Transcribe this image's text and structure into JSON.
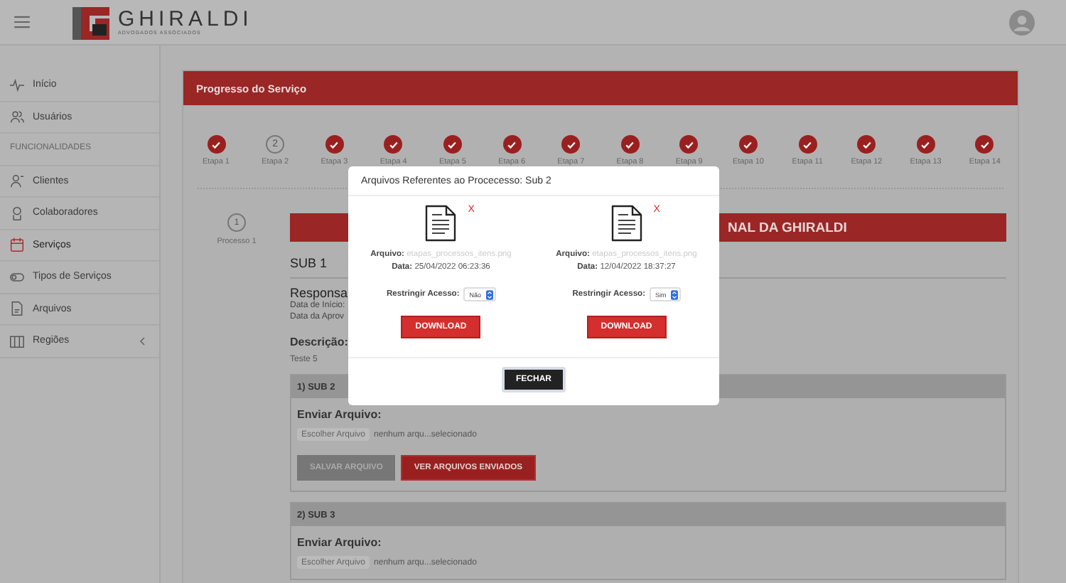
{
  "header": {
    "logo_text": "GHIRALDI",
    "logo_subtitle": "ADVOGADOS ASSOCIADOS"
  },
  "sidebar": {
    "items": [
      {
        "kind": "pulse",
        "label": "Início",
        "selected": false
      },
      {
        "kind": "users",
        "label": "Usuários",
        "selected": false
      },
      {
        "kind": "section",
        "label": "FUNCIONALIDADES"
      },
      {
        "kind": "user",
        "label": "Clientes",
        "selected": false
      },
      {
        "kind": "badge",
        "label": "Colaboradores",
        "selected": false
      },
      {
        "kind": "calendar",
        "label": "Serviços",
        "selected": true
      },
      {
        "kind": "toggle",
        "label": "Tipos de Serviços",
        "selected": false
      },
      {
        "kind": "file",
        "label": "Arquivos",
        "selected": false
      },
      {
        "kind": "map",
        "label": "Regiões",
        "selected": false,
        "expandable": true
      }
    ]
  },
  "card": {
    "title": "Progresso do Serviço",
    "steps": [
      {
        "label": "Etapa 1",
        "done": true
      },
      {
        "label": "Etapa 2",
        "done": false,
        "number": "2"
      },
      {
        "label": "Etapa 3",
        "done": true
      },
      {
        "label": "Etapa 4",
        "done": true
      },
      {
        "label": "Etapa 5",
        "done": true
      },
      {
        "label": "Etapa 6",
        "done": true
      },
      {
        "label": "Etapa 7",
        "done": true
      },
      {
        "label": "Etapa 8",
        "done": true
      },
      {
        "label": "Etapa 9",
        "done": true
      },
      {
        "label": "Etapa 10",
        "done": true
      },
      {
        "label": "Etapa 11",
        "done": true
      },
      {
        "label": "Etapa 12",
        "done": true
      },
      {
        "label": "Etapa 13",
        "done": true
      },
      {
        "label": "Etapa 14",
        "done": true
      }
    ],
    "process": {
      "number": "1",
      "label": "Processo 1"
    },
    "banner": "NAL DA GHIRALDI",
    "sub_title": "SUB 1",
    "responsible_heading": "Responsa",
    "date_lines": [
      "Data de Início:",
      "Data da Aprov"
    ],
    "description_heading": "Descrição:",
    "description": "Teste 5",
    "subs": [
      {
        "title": "1) SUB 2",
        "upload_label": "Enviar Arquivo:",
        "choose_button": "Escolher Arquivo",
        "no_file": "nenhum arqu...selecionado",
        "buttons": [
          {
            "label": "SALVAR ARQUIVO",
            "disabled": true
          },
          {
            "label": "VER ARQUIVOS ENVIADOS",
            "disabled": false
          }
        ]
      },
      {
        "title": "2) SUB 3",
        "upload_label": "Enviar Arquivo:",
        "choose_button": "Escolher Arquivo",
        "no_file": "nenhum arqu...selecionado"
      }
    ]
  },
  "modal": {
    "title": "Arquivos Referentes ao Procecesso: Sub 2",
    "files": [
      {
        "delete": "X",
        "file_label": "Arquivo:",
        "file_name": "etapas_processos_itens.png",
        "date_label": "Data:",
        "date": "25/04/2022 06:23:36",
        "restrict_label": "Restringir Acesso:",
        "restrict_value": "Não",
        "download": "DOWNLOAD"
      },
      {
        "delete": "X",
        "file_label": "Arquivo:",
        "file_name": "etapas_processos_itens.png",
        "date_label": "Data:",
        "date": "12/04/2022 18:37:27",
        "restrict_label": "Restringir Acesso:",
        "restrict_value": "Sim",
        "download": "DOWNLOAD"
      }
    ],
    "close_button": "FECHAR"
  }
}
